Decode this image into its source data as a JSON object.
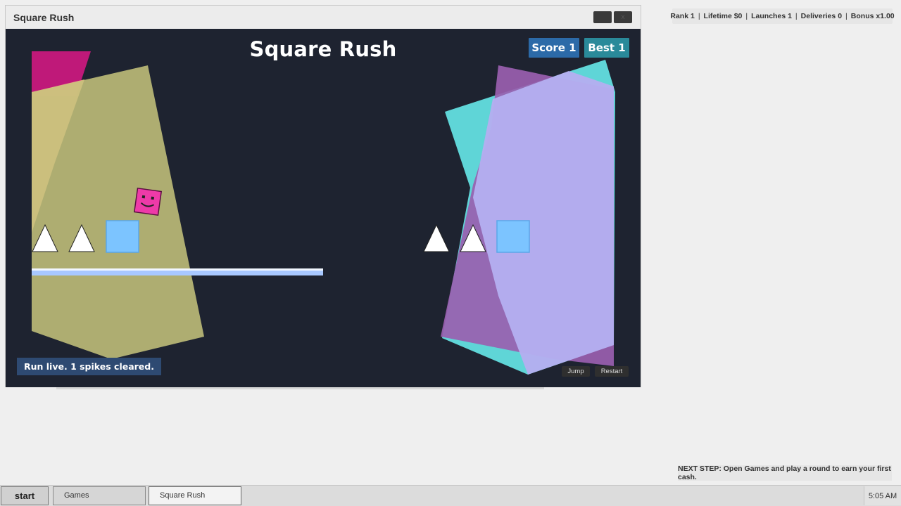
{
  "status_bar": {
    "items": [
      "Rank 1",
      "Lifetime $0",
      "Launches 1",
      "Deliveries 0",
      "Bonus x1.00"
    ]
  },
  "window": {
    "title": "Square Rush",
    "minimize_icon": "minimize-icon",
    "close_icon": "close-icon",
    "close_glyph": "x"
  },
  "game": {
    "title": "Square Rush",
    "score_label": "Score 1",
    "best_label": "Best 1",
    "status_message": "Run live. 1 spikes cleared.",
    "jump_label": "Jump",
    "restart_label": "Restart",
    "colors": {
      "background": "#1e2330",
      "player": "#ee3aa8",
      "block": "#7cc4ff",
      "spike": "#ffffff",
      "platform": "#a8c8ff"
    }
  },
  "hint": {
    "text": "NEXT STEP: Open Games and play a round to earn your first cash."
  },
  "taskbar": {
    "start_label": "start",
    "tasks": [
      "Games",
      "Square Rush"
    ],
    "clock": "5:05 AM"
  }
}
